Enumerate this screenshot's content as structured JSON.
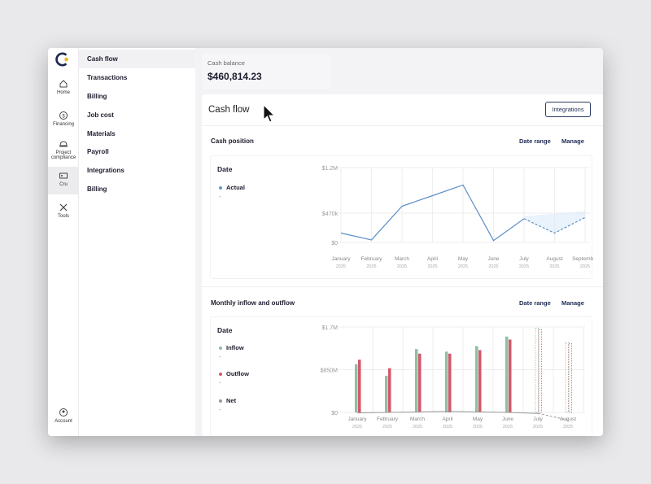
{
  "rail": {
    "items": [
      {
        "label": "Home",
        "icon": "home-icon"
      },
      {
        "label": "Financing",
        "icon": "dollar-circle-icon"
      },
      {
        "label": "Project compliance",
        "icon": "hardhat-icon"
      },
      {
        "label": "Cru",
        "icon": "id-card-icon"
      },
      {
        "label": "Tools",
        "icon": "tools-icon"
      },
      {
        "label": "Account",
        "icon": "user-circle-icon"
      }
    ]
  },
  "subnav": {
    "items": [
      "Cash flow",
      "Transactions",
      "Billing",
      "Job cost",
      "Materials",
      "Payroll",
      "Integrations",
      "Billing"
    ],
    "active": "Cash flow"
  },
  "balance": {
    "label": "Cash balance",
    "value": "$460,814.23"
  },
  "card": {
    "title": "Cash flow",
    "integrations_label": "Integrations"
  },
  "cash_position": {
    "title": "Cash position",
    "date_range_label": "Date range",
    "manage_label": "Manage",
    "legend_title": "Date",
    "legend": [
      {
        "name": "Actual",
        "value": "-",
        "color": "#5b9bd5"
      }
    ]
  },
  "monthly": {
    "title": "Monthly inflow and outflow",
    "date_range_label": "Date range",
    "manage_label": "Manage",
    "legend_title": "Date",
    "legend": [
      {
        "name": "Inflow",
        "value": "-",
        "color": "#8fbfa3"
      },
      {
        "name": "Outflow",
        "value": "-",
        "color": "#d3596b"
      },
      {
        "name": "Net",
        "value": "-",
        "color": "#999999"
      }
    ]
  },
  "chart_data": [
    {
      "type": "line",
      "categories": [
        "January",
        "February",
        "March",
        "April",
        "May",
        "June",
        "July",
        "August",
        "September"
      ],
      "years": [
        "2025",
        "2025",
        "2025",
        "2025",
        "2025",
        "2025",
        "2025",
        "2025",
        "2025"
      ],
      "ytick_labels": [
        "$1.2M",
        "$470k",
        "$0"
      ],
      "ylim": [
        0,
        1200000
      ],
      "series": [
        {
          "name": "Actual",
          "values": [
            150000,
            40000,
            580000,
            750000,
            920000,
            30000,
            380000,
            null,
            null
          ],
          "color": "#5b8fc7"
        },
        {
          "values": [
            null,
            null,
            null,
            null,
            null,
            null,
            380000,
            150000,
            400000
          ],
          "style": "dashed",
          "color": "#5b8fc7"
        }
      ],
      "grid": true
    },
    {
      "type": "bar",
      "categories": [
        "January",
        "February",
        "March",
        "April",
        "May",
        "June",
        "July",
        "August"
      ],
      "years": [
        "2025",
        "2025",
        "2025",
        "2025",
        "2025",
        "2025",
        "2025",
        "2025"
      ],
      "ytick_labels": [
        "$1.7M",
        "$850M",
        "$0"
      ],
      "ylim": [
        0,
        1700000
      ],
      "series": [
        {
          "name": "Inflow",
          "values": [
            960000,
            730000,
            1260000,
            1210000,
            1320000,
            1510000,
            1680000,
            1390000
          ],
          "color": "#8fbfa3"
        },
        {
          "name": "Outflow",
          "values": [
            1050000,
            880000,
            1170000,
            1170000,
            1240000,
            1450000,
            1650000,
            1370000
          ],
          "color": "#d3596b"
        },
        {
          "name": "Net",
          "values": [
            -10000,
            0,
            10000,
            20000,
            10000,
            0,
            -20000,
            -150000
          ],
          "color": "#999999"
        }
      ],
      "projected_from": "July",
      "grid": true
    }
  ]
}
